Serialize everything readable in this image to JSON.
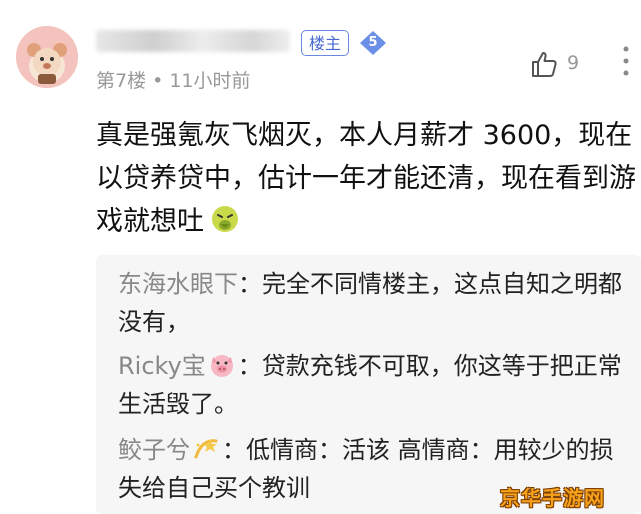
{
  "post": {
    "op_badge": "楼主",
    "level": "5",
    "floor": "第7楼",
    "separator": "•",
    "time": "11小时前",
    "likes": "9",
    "content": "真是强氪灰飞烟灭，本人月薪才 3600，现在以贷养贷中，估计一年才能还清，现在看到游戏就想吐"
  },
  "replies": [
    {
      "author": "东海水眼下",
      "separator": "：",
      "text": "完全不同情楼主，这点自知之明都没有，",
      "emoji": ""
    },
    {
      "author": "Ricky宝",
      "separator": "：",
      "text": "贷款充钱不可取，你这等于把正常生活毁了。",
      "emoji": "pig-face-icon"
    },
    {
      "author": "鲛子兮",
      "separator": "：",
      "text": "低情商：活该 高情商：用较少的损失给自己买个教训",
      "emoji": "dizzy-icon"
    }
  ],
  "watermark": "京华手游网",
  "colors": {
    "op_badge": "#4a6ad2",
    "level_badge": "#6b8fe6",
    "meta_text": "#999999",
    "reply_author": "#888888",
    "reply_bg": "#f6f6f6"
  }
}
